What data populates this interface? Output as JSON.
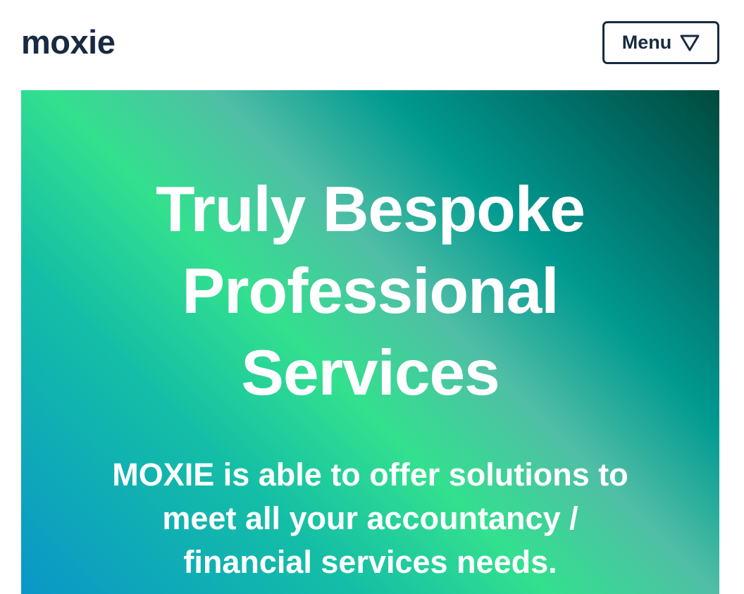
{
  "header": {
    "logo": "moxie",
    "menu_label": "Menu",
    "menu_icon": "triangle-down-outline-icon"
  },
  "hero": {
    "title_lines": [
      "Truly Bespoke",
      "Professional",
      "Services"
    ],
    "text_lines": [
      "MOXIE is able to offer solutions to",
      "meet all your accountancy /",
      "financial services needs."
    ],
    "gradient_colors": [
      "#004a3c",
      "#009a90",
      "#33e08e",
      "#0a97c8"
    ]
  },
  "colors": {
    "brand_dark": "#182a41",
    "hero_text": "#ffffff"
  }
}
